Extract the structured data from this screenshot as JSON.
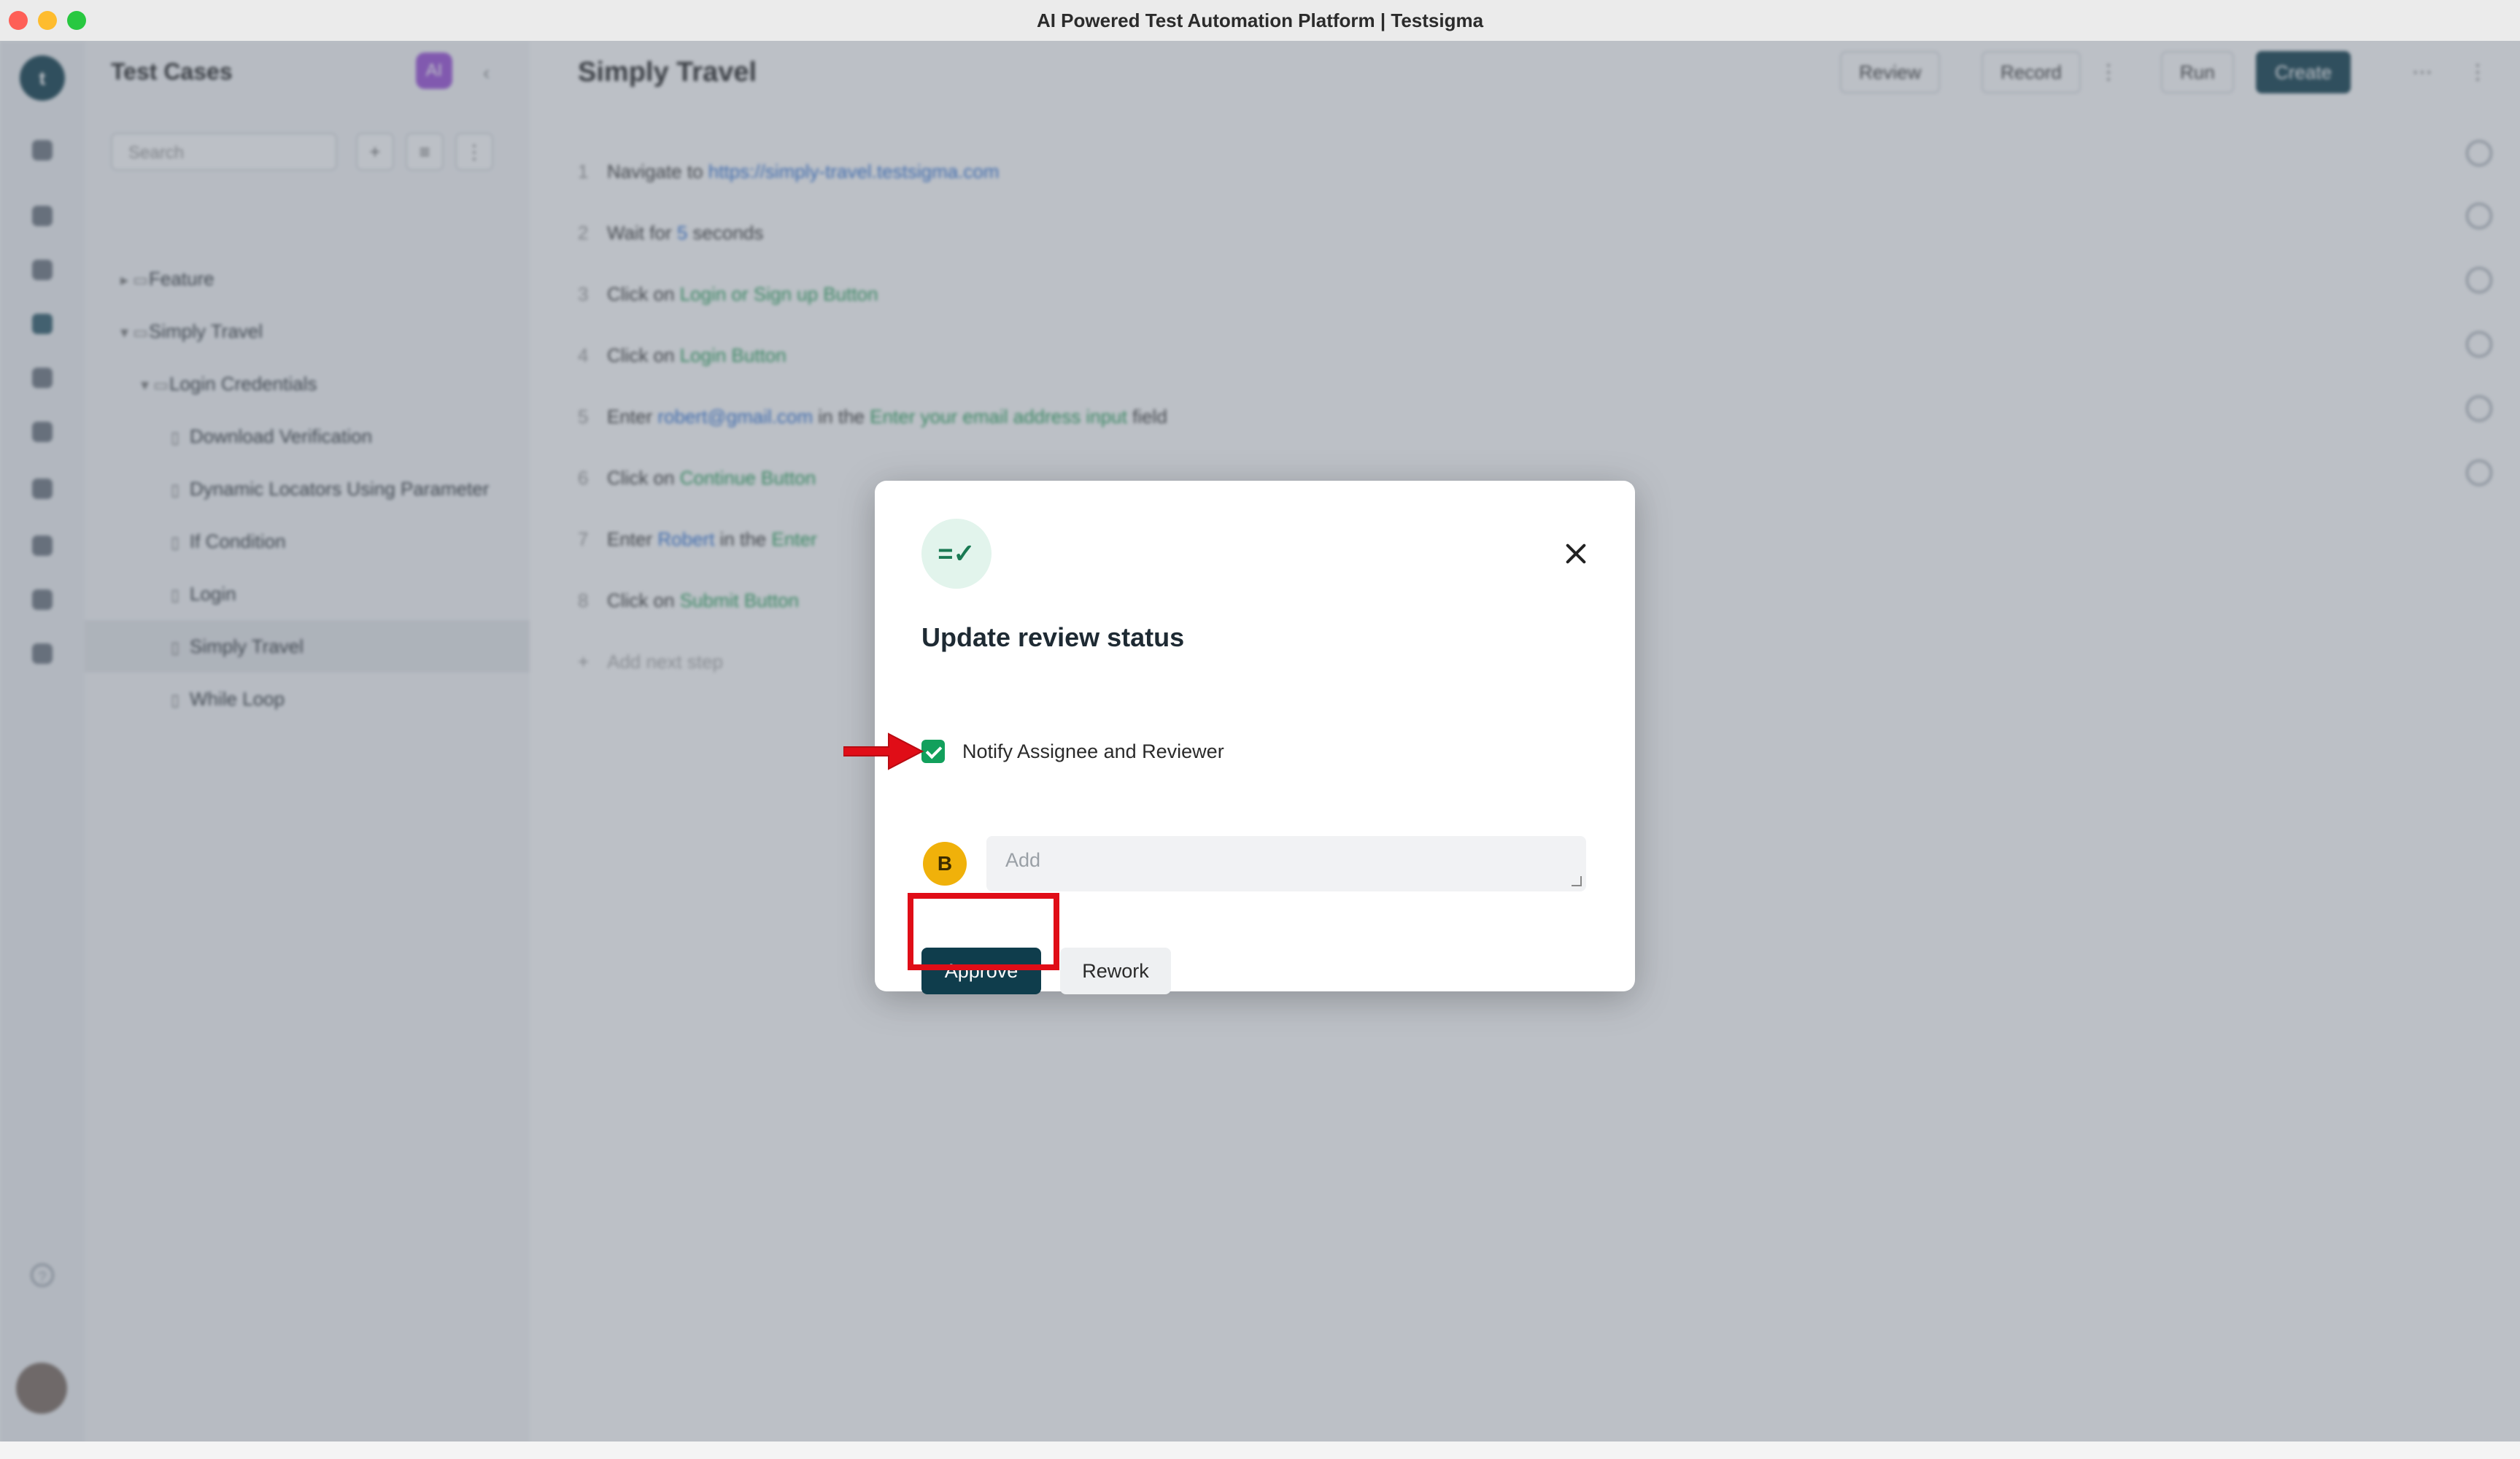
{
  "window": {
    "title": "AI Powered Test Automation Platform | Testsigma"
  },
  "rail": {
    "logo": "t"
  },
  "sidebar": {
    "title": "Test Cases",
    "ai_badge": "AI",
    "collapse_glyph": "‹",
    "search_placeholder": "Search",
    "tree": [
      {
        "label": "Feature",
        "glyph": "▸ ▭",
        "indent": 1
      },
      {
        "label": "Simply Travel",
        "glyph": "▾ ▭",
        "indent": 1
      },
      {
        "label": "Login Credentials",
        "glyph": "▾ ▭",
        "indent": 2
      },
      {
        "label": "Download Verification",
        "glyph": "▯",
        "indent": 3
      },
      {
        "label": "Dynamic Locators Using Parameter",
        "glyph": "▯",
        "indent": 3
      },
      {
        "label": "If Condition",
        "glyph": "▯",
        "indent": 3
      },
      {
        "label": "Login",
        "glyph": "▯",
        "indent": 3
      },
      {
        "label": "Simply Travel",
        "glyph": "▯",
        "indent": 3,
        "active": true
      },
      {
        "label": "While Loop",
        "glyph": "▯",
        "indent": 3
      }
    ]
  },
  "main": {
    "title": "Simply Travel",
    "header_buttons": {
      "review": "Review",
      "record": "Record",
      "run": "Run",
      "create": "Create"
    },
    "steps": [
      {
        "num": "1",
        "parts": [
          [
            "t",
            "Navigate to "
          ],
          [
            "k",
            "https://simply-travel.testsigma.com"
          ]
        ]
      },
      {
        "num": "2",
        "parts": [
          [
            "t",
            "Wait for "
          ],
          [
            "k",
            "5"
          ],
          [
            "t",
            " seconds"
          ]
        ]
      },
      {
        "num": "3",
        "parts": [
          [
            "t",
            "Click on "
          ],
          [
            "e",
            "Login or Sign up Button"
          ]
        ]
      },
      {
        "num": "4",
        "parts": [
          [
            "t",
            "Click on "
          ],
          [
            "e",
            "Login Button"
          ]
        ]
      },
      {
        "num": "5",
        "parts": [
          [
            "t",
            "Enter "
          ],
          [
            "k",
            "robert@gmail.com"
          ],
          [
            "t",
            " in the "
          ],
          [
            "e",
            "Enter your email address input"
          ],
          [
            "t",
            " field"
          ]
        ]
      },
      {
        "num": "6",
        "parts": [
          [
            "t",
            "Click on "
          ],
          [
            "e",
            "Continue Button"
          ]
        ]
      },
      {
        "num": "7",
        "parts": [
          [
            "t",
            "Enter "
          ],
          [
            "k",
            "Robert"
          ],
          [
            "t",
            " in the "
          ],
          [
            "e",
            "Enter"
          ]
        ]
      },
      {
        "num": "8",
        "parts": [
          [
            "t",
            "Click on "
          ],
          [
            "e",
            "Submit Button"
          ]
        ]
      },
      {
        "num": "+",
        "parts": [
          [
            "p",
            "Add next step"
          ]
        ]
      }
    ]
  },
  "modal": {
    "icon": "=✓",
    "title": "Update review status",
    "notify_label": "Notify Assignee and Reviewer",
    "notify_checked": true,
    "avatar_initial": "B",
    "comment_placeholder": "Add",
    "comment_value": "",
    "approve_label": "Approve",
    "rework_label": "Rework"
  },
  "annotations": {
    "arrow_color": "#e00d17",
    "box_color": "#e00d17"
  }
}
